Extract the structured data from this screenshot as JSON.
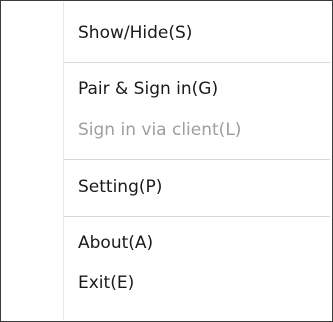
{
  "menu": {
    "items": [
      {
        "label": "Show/Hide(S)",
        "enabled": true
      },
      {
        "label": "Pair & Sign in(G)",
        "enabled": true
      },
      {
        "label": "Sign in via client(L)",
        "enabled": false
      },
      {
        "label": "Setting(P)",
        "enabled": true
      },
      {
        "label": "About(A)",
        "enabled": true
      },
      {
        "label": "Exit(E)",
        "enabled": true
      }
    ]
  },
  "colors": {
    "text": "#1a1a1a",
    "disabled_text": "#9e9e9e",
    "separator": "#d7d7d7",
    "border": "#3c3c3c"
  }
}
